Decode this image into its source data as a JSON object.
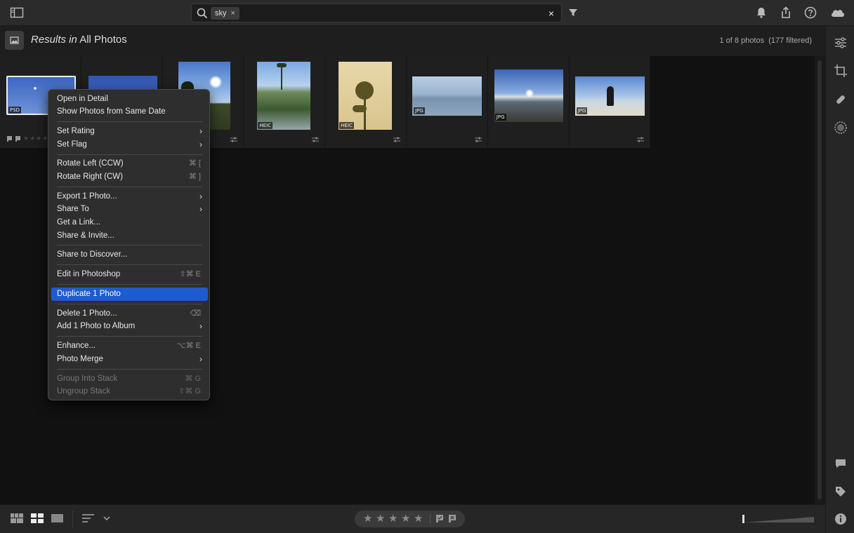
{
  "search": {
    "chip": "sky",
    "chip_remove": "×",
    "clear": "×"
  },
  "header": {
    "results_prefix": "Results in",
    "results_scope": "All Photos",
    "count": "1 of 8 photos",
    "filtered": "(177 filtered)"
  },
  "thumbnails": [
    {
      "badge": "PSD"
    },
    {
      "badge": ""
    },
    {
      "badge": ""
    },
    {
      "badge": "HEIC"
    },
    {
      "badge": "HEIC"
    },
    {
      "badge": "JPG"
    },
    {
      "badge": "JPG"
    },
    {
      "badge": "JPG"
    }
  ],
  "menu": {
    "open_detail": "Open in Detail",
    "show_same_date": "Show Photos from Same Date",
    "set_rating": "Set Rating",
    "set_flag": "Set Flag",
    "rotate_left": "Rotate Left (CCW)",
    "rotate_left_sc": "⌘ [",
    "rotate_right": "Rotate Right (CW)",
    "rotate_right_sc": "⌘ ]",
    "export": "Export 1 Photo...",
    "share_to": "Share To",
    "get_link": "Get a Link...",
    "share_invite": "Share & Invite...",
    "share_discover": "Share to Discover...",
    "edit_photoshop": "Edit in Photoshop",
    "edit_photoshop_sc": "⇧⌘ E",
    "duplicate": "Duplicate 1 Photo",
    "delete": "Delete 1 Photo...",
    "delete_sc": "⌫",
    "add_album": "Add 1 Photo to Album",
    "enhance": "Enhance...",
    "enhance_sc": "⌥⌘ E",
    "photo_merge": "Photo Merge",
    "group_stack": "Group Into Stack",
    "group_stack_sc": "⌘ G",
    "ungroup_stack": "Ungroup Stack",
    "ungroup_stack_sc": "⇧⌘ G",
    "submenu_glyph": "›"
  },
  "rating": {
    "stars": [
      "★",
      "★",
      "★",
      "★",
      "★"
    ]
  },
  "colors": {
    "accent": "#1f5bd0",
    "bg": "#111111",
    "panel": "#262626"
  }
}
